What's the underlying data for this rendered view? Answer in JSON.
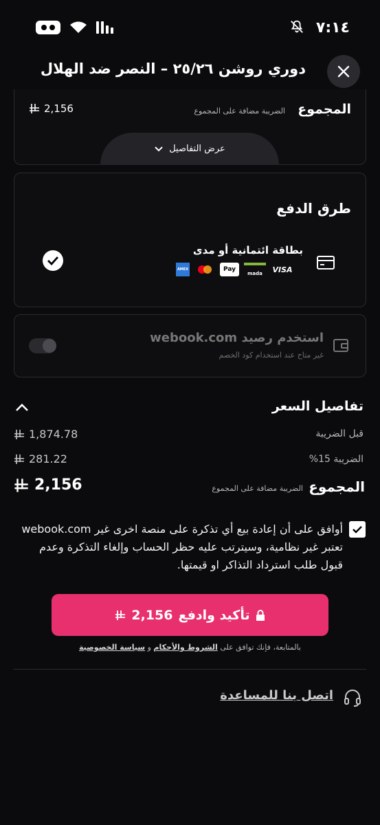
{
  "status_bar": {
    "time": "٧:١٤"
  },
  "header": {
    "title": "دوري روشن ٢٥/٢٦ – النصر ضد الهلال"
  },
  "summary": {
    "total_label": "المجموع",
    "tax_note": "الضريبة مضافة على المجموع",
    "total_value": "2,156",
    "show_details_label": "عرض التفاصيل"
  },
  "payment": {
    "title": "طرق الدفع",
    "method_label": "بطاقة ائتمانية أو مدى",
    "card_brands": [
      "VISA",
      "mada",
      "Pay",
      "mastercard",
      "AMEX"
    ]
  },
  "wallet": {
    "label": "استخدم رصيد webook.com",
    "note": "غير متاح عند استخدام كود الخصم"
  },
  "price_details": {
    "title": "تفاصيل السعر",
    "before_tax_label": "قبل الضريبة",
    "before_tax_value": "1,874.78",
    "tax_label": "الضريبة 15%",
    "tax_value": "281.22",
    "total_label": "المجموع",
    "total_note": "الضريبة مضافة على المجموع",
    "total_value": "2,156"
  },
  "agreement": {
    "text": "أوافق على أن إعادة بيع أي تذكرة على منصة اخرى غير webook.com تعتبر غير نظامية، وسيترتب عليه حظر الحساب وإلغاء التذكرة وعدم قبول طلب استرداد التذاكر او قيمتها."
  },
  "pay_button": {
    "label": "تأكيد وادفع",
    "amount": "2,156"
  },
  "legal": {
    "prefix": "بالمتابعة، فإنك توافق على",
    "terms": "الشروط والأحكام",
    "and": "و",
    "privacy": "سياسة الخصوصية"
  },
  "contact": {
    "label": "اتصل بنا للمساعدة"
  },
  "colors": {
    "accent": "#e8306e",
    "background": "#0b0b0d"
  }
}
